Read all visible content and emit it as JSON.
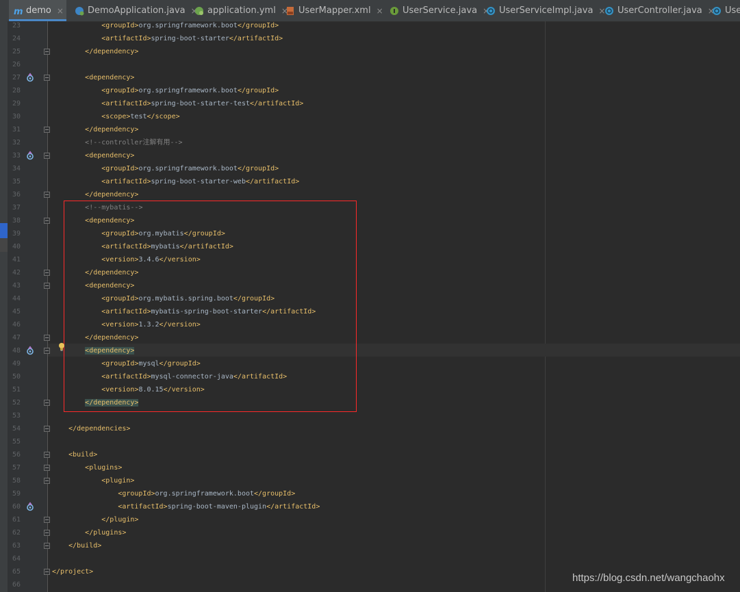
{
  "tabs": [
    {
      "label": "demo",
      "icon": "maven-m-icon",
      "active": true
    },
    {
      "label": "DemoApplication.java",
      "icon": "spring-boot-class-icon"
    },
    {
      "label": "application.yml",
      "icon": "spring-yml-icon"
    },
    {
      "label": "UserMapper.xml",
      "icon": "xml-file-icon"
    },
    {
      "label": "UserService.java",
      "icon": "interface-icon"
    },
    {
      "label": "UserServiceImpl.java",
      "icon": "class-icon"
    },
    {
      "label": "UserController.java",
      "icon": "class-icon"
    },
    {
      "label": "User",
      "icon": "class-icon"
    }
  ],
  "tab_close_glyph": "×",
  "colors": {
    "tag": "#e8bf6a",
    "text": "#a9b7c6",
    "comment": "#808080",
    "highlight_box": "#ff2a2a",
    "active_tab_line": "#4a88c7"
  },
  "code_lines": [
    {
      "n": "23",
      "fold": false,
      "icon": false,
      "tokens": [
        {
          "t": "            "
        },
        {
          "c": "tag",
          "t": "<groupId>"
        },
        {
          "t": "org.springframework.boot"
        },
        {
          "c": "tag",
          "t": "</groupId>"
        }
      ]
    },
    {
      "n": "24",
      "fold": false,
      "icon": false,
      "tokens": [
        {
          "t": "            "
        },
        {
          "c": "tag",
          "t": "<artifactId>"
        },
        {
          "t": "spring-boot-starter"
        },
        {
          "c": "tag",
          "t": "</artifactId>"
        }
      ]
    },
    {
      "n": "25",
      "fold": true,
      "icon": false,
      "tokens": [
        {
          "t": "        "
        },
        {
          "c": "tag",
          "t": "</dependency>"
        }
      ]
    },
    {
      "n": "26",
      "fold": false,
      "icon": false,
      "tokens": []
    },
    {
      "n": "27",
      "fold": true,
      "icon": true,
      "tokens": [
        {
          "t": "        "
        },
        {
          "c": "tag",
          "t": "<dependency>"
        }
      ]
    },
    {
      "n": "28",
      "fold": false,
      "icon": false,
      "tokens": [
        {
          "t": "            "
        },
        {
          "c": "tag",
          "t": "<groupId>"
        },
        {
          "t": "org.springframework.boot"
        },
        {
          "c": "tag",
          "t": "</groupId>"
        }
      ]
    },
    {
      "n": "29",
      "fold": false,
      "icon": false,
      "tokens": [
        {
          "t": "            "
        },
        {
          "c": "tag",
          "t": "<artifactId>"
        },
        {
          "t": "spring-boot-starter-test"
        },
        {
          "c": "tag",
          "t": "</artifactId>"
        }
      ]
    },
    {
      "n": "30",
      "fold": false,
      "icon": false,
      "tokens": [
        {
          "t": "            "
        },
        {
          "c": "tag",
          "t": "<scope>"
        },
        {
          "t": "test"
        },
        {
          "c": "tag",
          "t": "</scope>"
        }
      ]
    },
    {
      "n": "31",
      "fold": true,
      "icon": false,
      "tokens": [
        {
          "t": "        "
        },
        {
          "c": "tag",
          "t": "</dependency>"
        }
      ]
    },
    {
      "n": "32",
      "fold": false,
      "icon": false,
      "tokens": [
        {
          "t": "        "
        },
        {
          "c": "cmt",
          "t": "<!--controller注解有用-->"
        }
      ]
    },
    {
      "n": "33",
      "fold": true,
      "icon": true,
      "tokens": [
        {
          "t": "        "
        },
        {
          "c": "tag",
          "t": "<dependency>"
        }
      ]
    },
    {
      "n": "34",
      "fold": false,
      "icon": false,
      "tokens": [
        {
          "t": "            "
        },
        {
          "c": "tag",
          "t": "<groupId>"
        },
        {
          "t": "org.springframework.boot"
        },
        {
          "c": "tag",
          "t": "</groupId>"
        }
      ]
    },
    {
      "n": "35",
      "fold": false,
      "icon": false,
      "tokens": [
        {
          "t": "            "
        },
        {
          "c": "tag",
          "t": "<artifactId>"
        },
        {
          "t": "spring-boot-starter-web"
        },
        {
          "c": "tag",
          "t": "</artifactId>"
        }
      ]
    },
    {
      "n": "36",
      "fold": true,
      "icon": false,
      "tokens": [
        {
          "t": "        "
        },
        {
          "c": "tag",
          "t": "</dependency>"
        }
      ]
    },
    {
      "n": "37",
      "fold": false,
      "icon": false,
      "tokens": [
        {
          "t": "        "
        },
        {
          "c": "cmt",
          "t": "<!--mybatis-->"
        }
      ]
    },
    {
      "n": "38",
      "fold": true,
      "icon": false,
      "tokens": [
        {
          "t": "        "
        },
        {
          "c": "tag",
          "t": "<dependency>"
        }
      ]
    },
    {
      "n": "39",
      "fold": false,
      "icon": false,
      "tokens": [
        {
          "t": "            "
        },
        {
          "c": "tag",
          "t": "<groupId>"
        },
        {
          "t": "org.mybatis"
        },
        {
          "c": "tag",
          "t": "</groupId>"
        }
      ]
    },
    {
      "n": "40",
      "fold": false,
      "icon": false,
      "tokens": [
        {
          "t": "            "
        },
        {
          "c": "tag",
          "t": "<artifactId>"
        },
        {
          "t": "mybatis"
        },
        {
          "c": "tag",
          "t": "</artifactId>"
        }
      ]
    },
    {
      "n": "41",
      "fold": false,
      "icon": false,
      "tokens": [
        {
          "t": "            "
        },
        {
          "c": "tag",
          "t": "<version>"
        },
        {
          "t": "3.4.6"
        },
        {
          "c": "tag",
          "t": "</version>"
        }
      ]
    },
    {
      "n": "42",
      "fold": true,
      "icon": false,
      "tokens": [
        {
          "t": "        "
        },
        {
          "c": "tag",
          "t": "</dependency>"
        }
      ]
    },
    {
      "n": "43",
      "fold": true,
      "icon": false,
      "tokens": [
        {
          "t": "        "
        },
        {
          "c": "tag",
          "t": "<dependency>"
        }
      ]
    },
    {
      "n": "44",
      "fold": false,
      "icon": false,
      "tokens": [
        {
          "t": "            "
        },
        {
          "c": "tag",
          "t": "<groupId>"
        },
        {
          "t": "org.mybatis.spring.boot"
        },
        {
          "c": "tag",
          "t": "</groupId>"
        }
      ]
    },
    {
      "n": "45",
      "fold": false,
      "icon": false,
      "tokens": [
        {
          "t": "            "
        },
        {
          "c": "tag",
          "t": "<artifactId>"
        },
        {
          "t": "mybatis-spring-boot-starter"
        },
        {
          "c": "tag",
          "t": "</artifactId>"
        }
      ]
    },
    {
      "n": "46",
      "fold": false,
      "icon": false,
      "tokens": [
        {
          "t": "            "
        },
        {
          "c": "tag",
          "t": "<version>"
        },
        {
          "t": "1.3.2"
        },
        {
          "c": "tag",
          "t": "</version>"
        }
      ]
    },
    {
      "n": "47",
      "fold": true,
      "icon": false,
      "tokens": [
        {
          "t": "        "
        },
        {
          "c": "tag",
          "t": "</dependency>"
        }
      ]
    },
    {
      "n": "48",
      "fold": true,
      "icon": true,
      "tokens": [
        {
          "t": "        "
        },
        {
          "c": "tag",
          "t": "<dependency>",
          "hl": true
        }
      ]
    },
    {
      "n": "49",
      "fold": false,
      "icon": false,
      "tokens": [
        {
          "t": "            "
        },
        {
          "c": "tag",
          "t": "<groupId>"
        },
        {
          "t": "mysql"
        },
        {
          "c": "tag",
          "t": "</groupId>"
        }
      ]
    },
    {
      "n": "50",
      "fold": false,
      "icon": false,
      "tokens": [
        {
          "t": "            "
        },
        {
          "c": "tag",
          "t": "<artifactId>"
        },
        {
          "t": "mysql-connector-java"
        },
        {
          "c": "tag",
          "t": "</artifactId>"
        }
      ]
    },
    {
      "n": "51",
      "fold": false,
      "icon": false,
      "tokens": [
        {
          "t": "            "
        },
        {
          "c": "tag",
          "t": "<version>"
        },
        {
          "t": "8.0.15"
        },
        {
          "c": "tag",
          "t": "</version>"
        }
      ]
    },
    {
      "n": "52",
      "fold": true,
      "icon": false,
      "tokens": [
        {
          "t": "        "
        },
        {
          "c": "tag",
          "t": "</dependency>",
          "hl": true
        }
      ]
    },
    {
      "n": "53",
      "fold": false,
      "icon": false,
      "tokens": []
    },
    {
      "n": "54",
      "fold": true,
      "icon": false,
      "tokens": [
        {
          "t": "    "
        },
        {
          "c": "tag",
          "t": "</dependencies>"
        }
      ]
    },
    {
      "n": "55",
      "fold": false,
      "icon": false,
      "tokens": []
    },
    {
      "n": "56",
      "fold": true,
      "icon": false,
      "tokens": [
        {
          "t": "    "
        },
        {
          "c": "tag",
          "t": "<build>"
        }
      ]
    },
    {
      "n": "57",
      "fold": true,
      "icon": false,
      "tokens": [
        {
          "t": "        "
        },
        {
          "c": "tag",
          "t": "<plugins>"
        }
      ]
    },
    {
      "n": "58",
      "fold": true,
      "icon": false,
      "tokens": [
        {
          "t": "            "
        },
        {
          "c": "tag",
          "t": "<plugin>"
        }
      ]
    },
    {
      "n": "59",
      "fold": false,
      "icon": false,
      "tokens": [
        {
          "t": "                "
        },
        {
          "c": "tag",
          "t": "<groupId>"
        },
        {
          "t": "org.springframework.boot"
        },
        {
          "c": "tag",
          "t": "</groupId>"
        }
      ]
    },
    {
      "n": "60",
      "fold": false,
      "icon": true,
      "tokens": [
        {
          "t": "                "
        },
        {
          "c": "tag",
          "t": "<artifactId>"
        },
        {
          "t": "spring-boot-maven-plugin"
        },
        {
          "c": "tag",
          "t": "</artifactId>"
        }
      ]
    },
    {
      "n": "61",
      "fold": true,
      "icon": false,
      "tokens": [
        {
          "t": "            "
        },
        {
          "c": "tag",
          "t": "</plugin>"
        }
      ]
    },
    {
      "n": "62",
      "fold": true,
      "icon": false,
      "tokens": [
        {
          "t": "        "
        },
        {
          "c": "tag",
          "t": "</plugins>"
        }
      ]
    },
    {
      "n": "63",
      "fold": true,
      "icon": false,
      "tokens": [
        {
          "t": "    "
        },
        {
          "c": "tag",
          "t": "</build>"
        }
      ]
    },
    {
      "n": "64",
      "fold": false,
      "icon": false,
      "tokens": []
    },
    {
      "n": "65",
      "fold": true,
      "icon": false,
      "tokens": [
        {
          "c": "tag",
          "t": "</project>"
        }
      ]
    },
    {
      "n": "66",
      "fold": false,
      "icon": false,
      "tokens": []
    }
  ],
  "watermark": "https://blog.csdn.net/wangchaohx"
}
